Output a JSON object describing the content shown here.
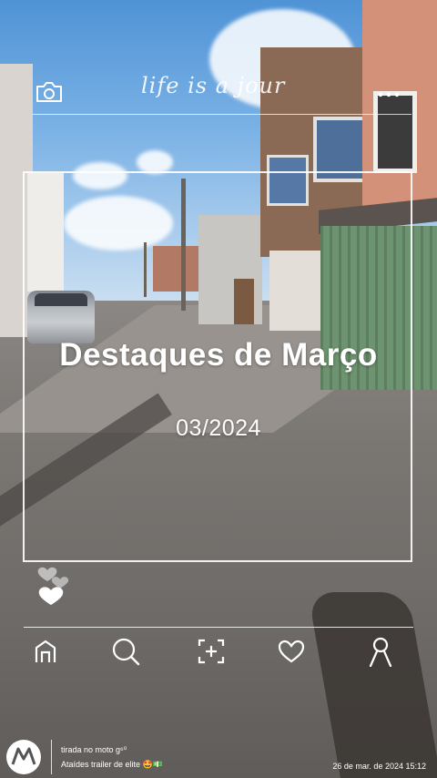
{
  "header": {
    "brand_text": "life is a jour",
    "camera_icon": "camera-icon",
    "more_icon": "more-dots-icon"
  },
  "card": {
    "title": "Destaques de Março",
    "subtitle": "03/2024"
  },
  "nav": {
    "items": [
      {
        "icon": "home-icon"
      },
      {
        "icon": "search-icon"
      },
      {
        "icon": "add-photo-icon"
      },
      {
        "icon": "heart-icon"
      },
      {
        "icon": "profile-icon"
      }
    ]
  },
  "watermark": {
    "logo": "motorola-logo",
    "line1": "tirada no moto g⁶⁰",
    "line2": "Ataídes trailer de elite 🤩💵",
    "datetime": "26 de mar. de 2024 15:12"
  },
  "colors": {
    "overlay": "#ffffff",
    "sky": "#4f93d6",
    "road": "#7a7773"
  }
}
